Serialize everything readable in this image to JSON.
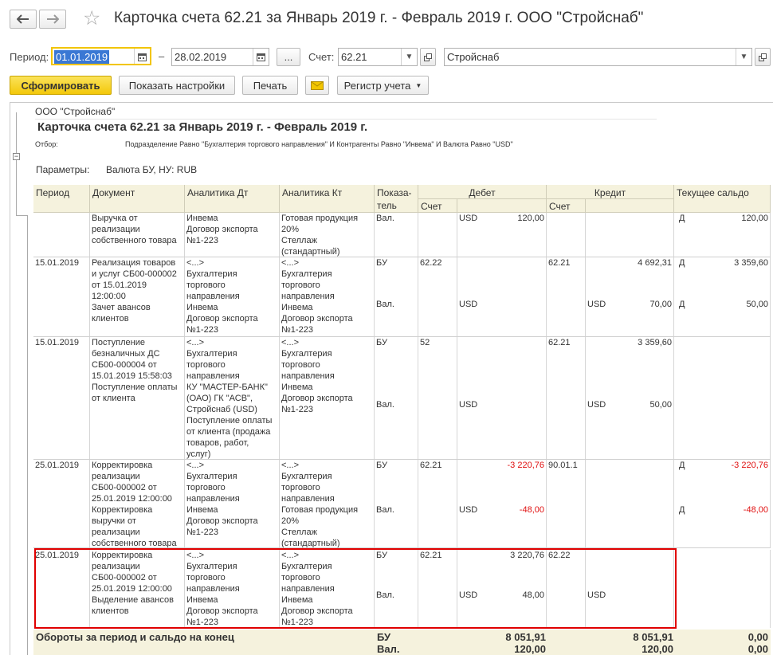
{
  "window": {
    "title": "Карточка счета 62.21 за Январь 2019 г. - Февраль 2019 г. ООО \"Стройснаб\""
  },
  "filters": {
    "period_label": "Период:",
    "date_from": "01.01.2019",
    "dash": "–",
    "date_to": "28.02.2019",
    "ellipsis": "...",
    "account_label": "Счет:",
    "account": "62.21",
    "organization": "Стройснаб"
  },
  "toolbar": {
    "generate": "Сформировать",
    "show_settings": "Показать настройки",
    "print": "Печать",
    "register": "Регистр учета"
  },
  "report": {
    "org": "ООО \"Стройснаб\"",
    "heading": "Карточка счета 62.21 за Январь 2019 г. - Февраль 2019 г.",
    "filter_label": "Отбор:",
    "filter_text": "Подразделение Равно \"Бухгалтерия торгового направления\" И Контрагенты Равно \"Инвема\" И Валюта Равно \"USD\"",
    "params_label": "Параметры:",
    "params_text": "Валюта БУ, НУ: RUB",
    "columns": {
      "period": "Период",
      "document": "Документ",
      "analytics_dt": "Аналитика Дт",
      "analytics_kt": "Аналитика Кт",
      "indicator": "Показа-\nтель",
      "debit": "Дебет",
      "credit": "Кредит",
      "balance": "Текущее сальдо",
      "account_dt": "Счет",
      "account_kt": "Счет"
    },
    "rows": [
      {
        "period": "",
        "document": "Выручка от\nреализации\nсобственного товара",
        "analytics_dt": "Инвема\nДоговор экспорта\n№1-223",
        "analytics_kt": "Готовая продукция\n20%\nСтеллаж\n(стандартный)",
        "ind1": "Вал.",
        "ind2": "",
        "dt_acc": "",
        "dt_cur1": "USD",
        "dt_val1": "120,00",
        "dt_cur2": "",
        "dt_val2": "",
        "kt_acc": "",
        "kt_cur1": "",
        "kt_val1": "",
        "kt_cur2": "",
        "kt_val2": "",
        "bal_s1": "Д",
        "bal_v1": "120,00",
        "bal_s2": "",
        "bal_v2": ""
      },
      {
        "period": "15.01.2019",
        "document": "Реализация товаров\nи услуг СБ00-000002\nот 15.01.2019\n12:00:00\nЗачет авансов\nклиентов",
        "analytics_dt": "<...>\nБухгалтерия\nторгового\nнаправления\nИнвема\nДоговор экспорта\n№1-223",
        "analytics_kt": "<...>\nБухгалтерия\nторгового\nнаправления\nИнвема\nДоговор экспорта\n№1-223",
        "ind1": "БУ",
        "ind2": "Вал.",
        "dt_acc": "62.22",
        "dt_cur1": "",
        "dt_val1": "",
        "dt_cur2": "USD",
        "dt_val2": "",
        "kt_acc": "62.21",
        "kt_cur1": "",
        "kt_val1": "4 692,31",
        "kt_cur2": "USD",
        "kt_val2": "70,00",
        "bal_s1": "Д",
        "bal_v1": "3 359,60",
        "bal_s2": "Д",
        "bal_v2": "50,00"
      },
      {
        "period": "15.01.2019",
        "document": "Поступление\nбезналичных ДС\nСБ00-000004 от\n15.01.2019 15:58:03\nПоступление оплаты\nот клиента",
        "analytics_dt": "<...>\nБухгалтерия\nторгового\nнаправления\nКУ \"МАСТЕР-БАНК\"\n(ОАО) ГК \"АСВ\",\nСтройснаб (USD)\nПоступление оплаты\nот клиента (продажа\nтоваров, работ,\nуслуг)",
        "analytics_kt": "<...>\nБухгалтерия\nторгового\nнаправления\nИнвема\nДоговор экспорта\n№1-223",
        "ind1": "БУ",
        "ind2": "Вал.",
        "dt_acc": "52",
        "dt_cur1": "",
        "dt_val1": "",
        "dt_cur2": "USD",
        "dt_val2": "",
        "kt_acc": "62.21",
        "kt_cur1": "",
        "kt_val1": "3 359,60",
        "kt_cur2": "USD",
        "kt_val2": "50,00",
        "bal_s1": "",
        "bal_v1": "",
        "bal_s2": "",
        "bal_v2": ""
      },
      {
        "period": "25.01.2019",
        "document": "Корректировка\nреализации\nСБ00-000002 от\n25.01.2019 12:00:00\nКорректировка\nвыручки от\nреализации\nсобственного товара",
        "analytics_dt": "<...>\nБухгалтерия\nторгового\nнаправления\nИнвема\nДоговор экспорта\n№1-223",
        "analytics_kt": "<...>\nБухгалтерия\nторгового\nнаправления\nГотовая продукция\n20%\nСтеллаж\n(стандартный)",
        "ind1": "БУ",
        "ind2": "Вал.",
        "dt_acc": "62.21",
        "dt_cur1": "",
        "dt_val1": "-3 220,76",
        "dt_cur2": "USD",
        "dt_val2": "-48,00",
        "kt_acc": "90.01.1",
        "kt_cur1": "",
        "kt_val1": "",
        "kt_cur2": "",
        "kt_val2": "",
        "bal_s1": "Д",
        "bal_v1": "-3 220,76",
        "bal_s2": "Д",
        "bal_v2": "-48,00"
      },
      {
        "period": "25.01.2019",
        "document": "Корректировка\nреализации\nСБ00-000002 от\n25.01.2019 12:00:00\nВыделение авансов\nклиентов",
        "analytics_dt": "<...>\nБухгалтерия\nторгового\nнаправления\nИнвема\nДоговор экспорта\n№1-223",
        "analytics_kt": "<...>\nБухгалтерия\nторгового\nнаправления\nИнвема\nДоговор экспорта\n№1-223",
        "ind1": "БУ",
        "ind2": "Вал.",
        "dt_acc": "62.21",
        "dt_cur1": "",
        "dt_val1": "3 220,76",
        "dt_cur2": "USD",
        "dt_val2": "48,00",
        "kt_acc": "62.22",
        "kt_cur1": "",
        "kt_val1": "",
        "kt_cur2": "USD",
        "kt_val2": "",
        "bal_s1": "",
        "bal_v1": "",
        "bal_s2": "",
        "bal_v2": ""
      }
    ],
    "totals": {
      "label": "Обороты за период и сальдо на конец",
      "ind1": "БУ",
      "ind2": "Вал.",
      "debit1": "8 051,91",
      "debit2": "120,00",
      "credit1": "8 051,91",
      "credit2": "120,00",
      "bal1": "0,00",
      "bal2": "0,00"
    }
  }
}
